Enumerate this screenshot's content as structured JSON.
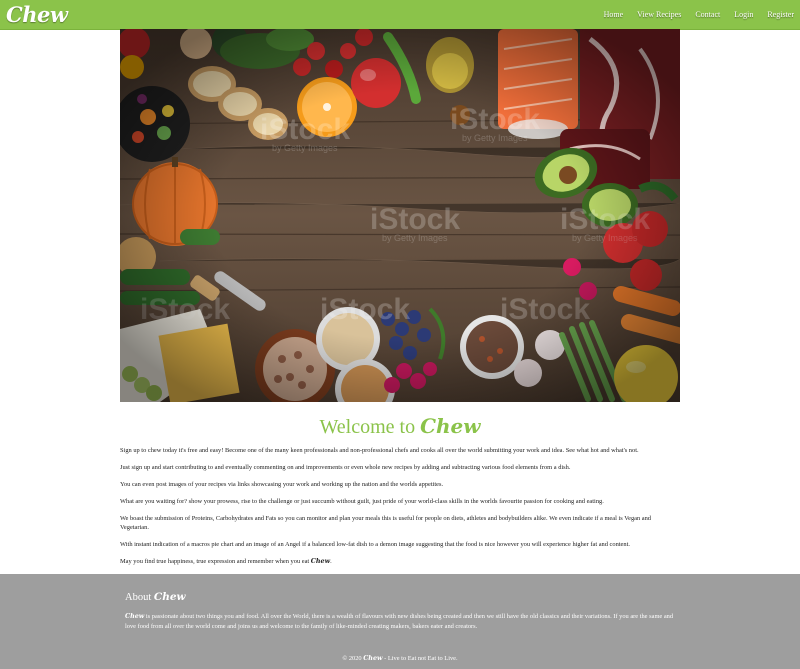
{
  "brand": "Chew",
  "nav": {
    "home": "Home",
    "view_recipes": "View Recipes",
    "contact": "Contact",
    "login": "Login",
    "register": "Register"
  },
  "hero": {
    "image_name": "ingredients-on-wooden-table",
    "watermark": "iStock",
    "watermark_sub": "by Getty Images"
  },
  "welcome": {
    "prefix": "Welcome to",
    "brand": "Chew"
  },
  "paragraphs": [
    "Sign up to chew today it's free and easy! Become one of the many keen professionals and non-professional chefs and cooks all over the world submitting your work and idea. See what hot and what's not.",
    "Just sign up and start contributing to and eventually commenting on and improvements or even whole new recipes by adding and subtracting various food elements from a dish.",
    "You can even post images of your recipes via links showcasing your work and working up the nation and the worlds appetites.",
    "What are you waiting for? show your prowess, rise to the challenge or just succumb without guilt, just pride of your world-class skills in the worlds favourite passion for cooking and eating.",
    "We boast the submission of Proteins, Carbohydrates and Fats so you can monitor and plan your meals this is useful for people on diets, athletes and bodybuilders alike. We even indicate if a meal is Vegan and Vegetarian.",
    "With instant indication of a macros pie chart and an image of an Angel if a balanced low-fat dish to a demon image suggesting that the food is nice however you will experience higher fat and content."
  ],
  "closing": {
    "prefix": "May you find true happiness, true expression and remember when you eat",
    "brand": "Chew",
    "suffix": "."
  },
  "footer": {
    "about_prefix": "About",
    "about_brand": "Chew",
    "about_brand_inline": "Chew",
    "about_text": " is passionate about two things you and food. All over the World, there is a wealth of flavours with new dishes being created and then we still have the old classics and their variations. If you are the same and love food from all over the world come and joins us and welcome to the family of like-minded creating makers, bakers eater and creators.",
    "copyright_prefix": "© 2020",
    "copyright_brand": "Chew",
    "copyright_suffix": "- Live to Eat not Eat to Live."
  },
  "colors": {
    "brand_green": "#8bc34a",
    "footer_gray": "#9e9e9e",
    "wood": "#5a4636"
  }
}
